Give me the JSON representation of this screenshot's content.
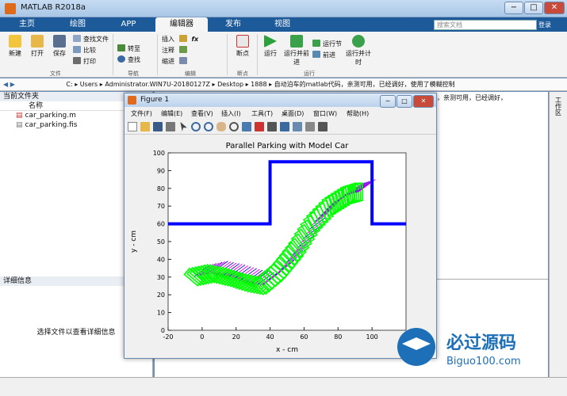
{
  "window": {
    "title": "MATLAB R2018a",
    "min": "−",
    "max": "□",
    "close": "✕"
  },
  "tabs": [
    {
      "label": "主页"
    },
    {
      "label": "绘图"
    },
    {
      "label": "APP"
    },
    {
      "label": "编辑器"
    },
    {
      "label": "发布"
    },
    {
      "label": "视图"
    }
  ],
  "search": {
    "placeholder": "搜索文档",
    "button": "登录"
  },
  "ribbon": {
    "file": {
      "new": "新建",
      "open": "打开",
      "save": "保存",
      "find_files": "查找文件",
      "compare": "比较",
      "print": "打印",
      "group": "文件"
    },
    "nav": {
      "goto": "转至",
      "find": "查找",
      "group": "导航"
    },
    "edit": {
      "insert": "插入",
      "comment": "注释",
      "indent": "缩进",
      "fx": "fx",
      "group": "编辑"
    },
    "breakpoint": {
      "label": "断点",
      "group": "断点"
    },
    "run": {
      "run": "运行",
      "run_advance": "运行并前进",
      "run_section": "运行节",
      "advance": "前进",
      "run_time": "运行并计时",
      "group": "运行"
    }
  },
  "path": {
    "segments": [
      "C:",
      "Users",
      "Administrator.WIN7U-20180127Z",
      "Desktop",
      "1888",
      "自动泊车的matlab代码，亲测可用，已经调好，使用了模糊控制"
    ]
  },
  "leftpanel": {
    "title": "当前文件夹",
    "col": "名称",
    "files": [
      "car_parking.m",
      "car_parking.fis"
    ],
    "details_title": "详细信息",
    "details_msg": "选择文件以查看详细信息"
  },
  "rightstrip": {
    "label": "工作区"
  },
  "editor_overlap": "，亲测可用，已经调好，",
  "figure": {
    "title": "Figure 1",
    "menu": [
      "文件(F)",
      "编辑(E)",
      "查看(V)",
      "插入(I)",
      "工具(T)",
      "桌面(D)",
      "窗口(W)",
      "帮助(H)"
    ]
  },
  "colors": {
    "boundary": "#0000ff",
    "car_green": "#00ff00",
    "car_blue": "#1f1fcc",
    "car_magenta": "#ff00ff",
    "ribbon_tab": "#1c5a9a"
  },
  "watermark": {
    "text1": "必过源码",
    "text2": "Biguo100.com"
  },
  "chart_data": {
    "type": "line",
    "title": "Parallel Parking with Model Car",
    "xlabel": "x - cm",
    "ylabel": "y - cm",
    "xlim": [
      -20,
      120
    ],
    "ylim": [
      0,
      100
    ],
    "xticks": [
      -20,
      0,
      20,
      40,
      60,
      80,
      100
    ],
    "yticks": [
      0,
      10,
      20,
      30,
      40,
      50,
      60,
      70,
      80,
      90,
      100
    ],
    "grid": false,
    "boundary": {
      "x": [
        -20,
        40,
        40,
        100,
        100,
        120
      ],
      "y": [
        60,
        60,
        95,
        95,
        60,
        60
      ]
    },
    "trajectory": {
      "x": [
        -5,
        5,
        15,
        25,
        35,
        45,
        55,
        65,
        75,
        85,
        92
      ],
      "y": [
        30,
        32,
        30,
        27,
        25,
        33,
        45,
        60,
        70,
        76,
        78
      ]
    },
    "car_orientation_deg": [
      -40,
      -45,
      -50,
      -50,
      -45,
      -40,
      -50,
      -60,
      -70,
      -80,
      -90
    ]
  }
}
